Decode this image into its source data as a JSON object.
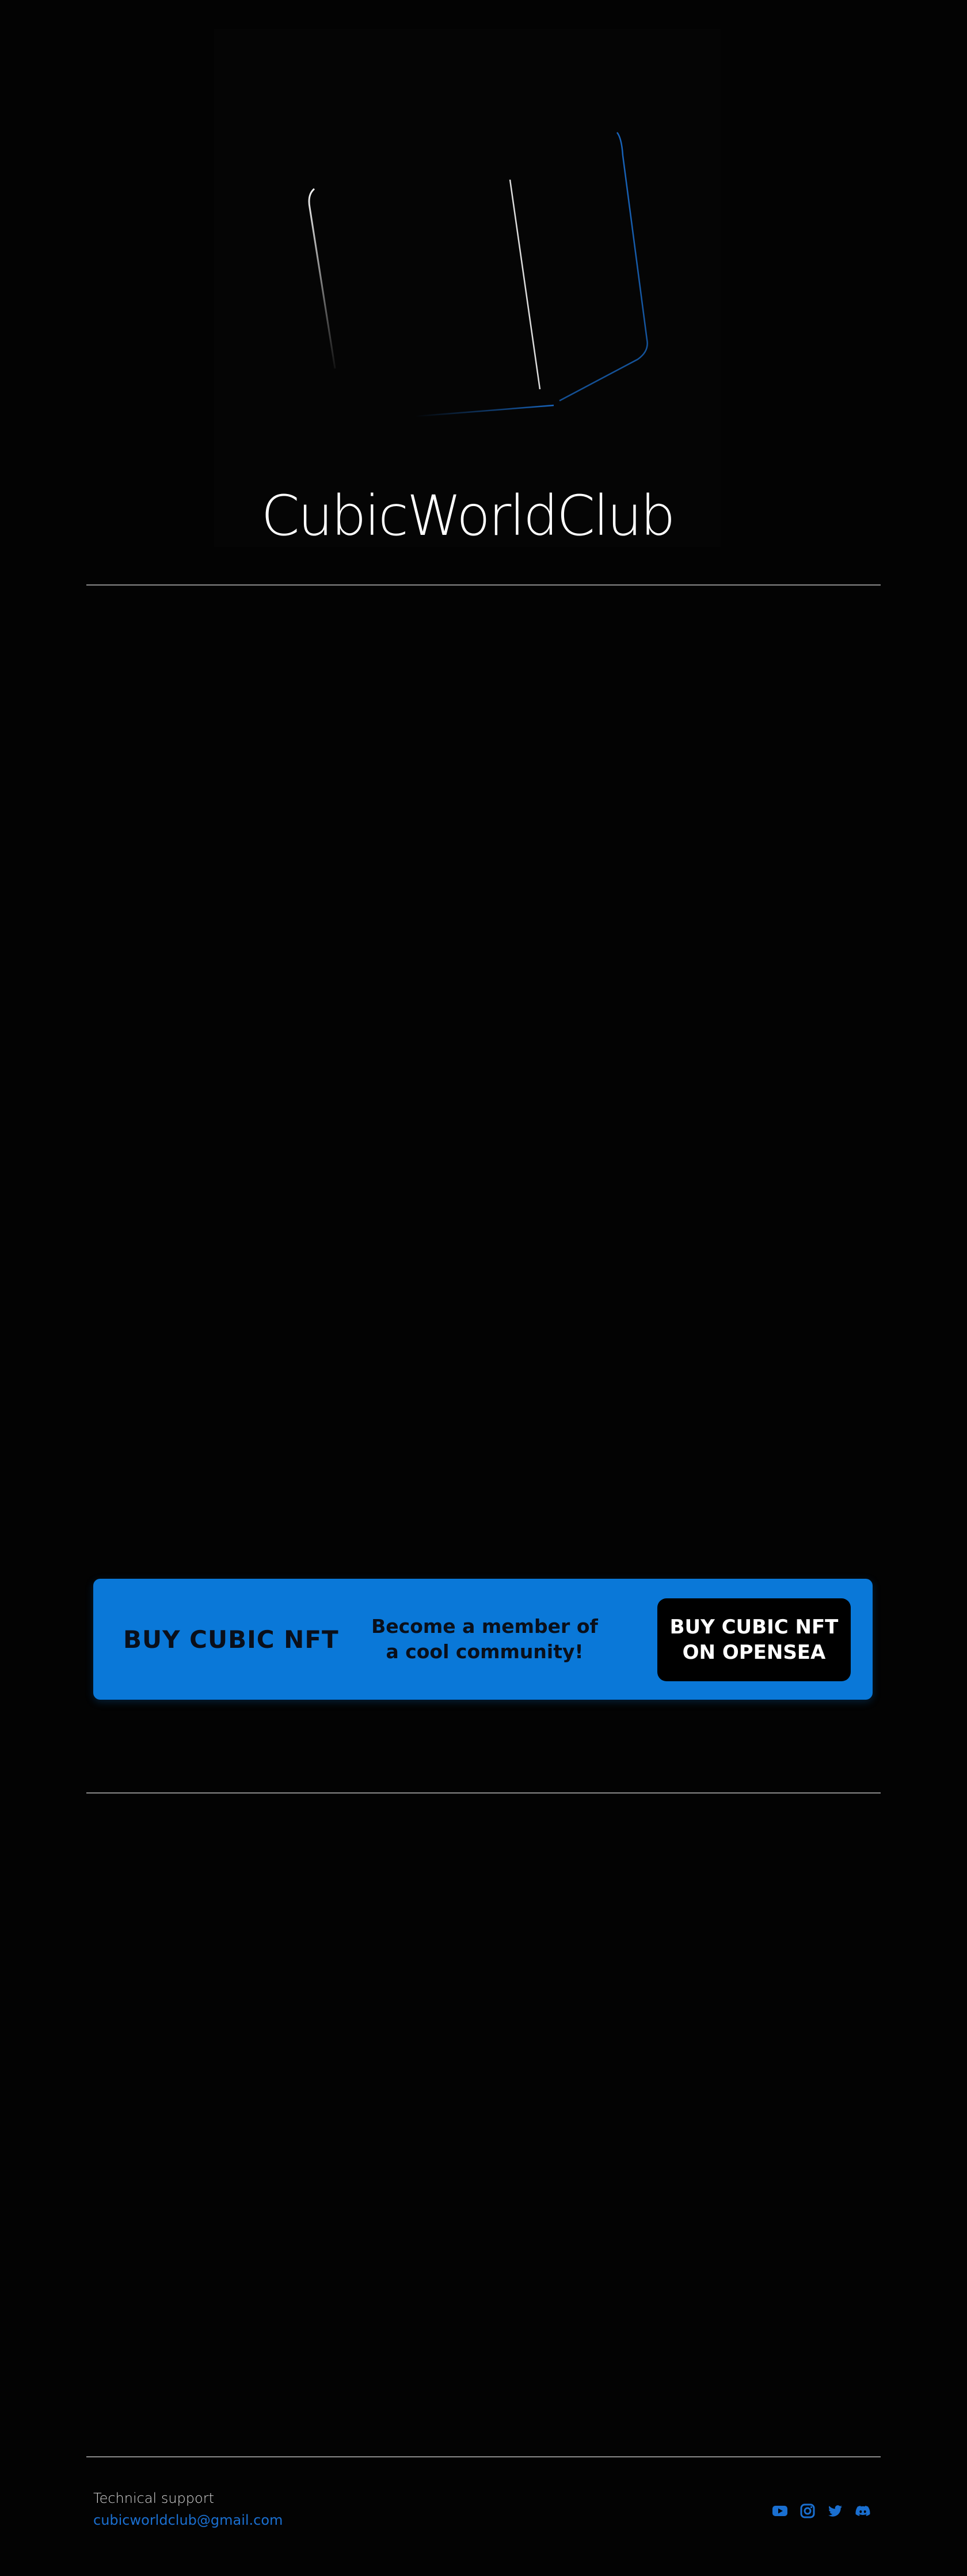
{
  "brand": {
    "title": "CubicWorldClub"
  },
  "cta": {
    "heading": "BUY CUBIC NFT",
    "text": "Become a member of\na cool community!",
    "button_label": "BUY CUBIC NFT\nON OPENSEA"
  },
  "footer": {
    "support_label": "Technical support",
    "support_email": "cubicworldclub@gmail.com",
    "socials": [
      {
        "icon": "youtube-icon"
      },
      {
        "icon": "instagram-icon"
      },
      {
        "icon": "twitter-icon"
      },
      {
        "icon": "discord-icon"
      }
    ]
  },
  "colors": {
    "background": "#030303",
    "accent": "#0a78d8",
    "link": "#1a6fd0",
    "divider": "#8a8a8a"
  }
}
